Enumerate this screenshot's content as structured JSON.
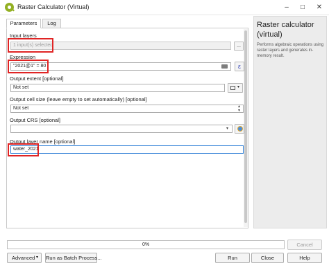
{
  "window": {
    "title": "Raster Calculator (Virtual)"
  },
  "tabs": [
    {
      "label": "Parameters"
    },
    {
      "label": "Log"
    }
  ],
  "params": {
    "input_layers": {
      "label": "Input layers",
      "value": "1 input(s) selected",
      "button": "..."
    },
    "expression": {
      "label": "Expression",
      "value": "\"2021@1\" = 80",
      "button": "ε"
    },
    "output_extent": {
      "label": "Output extent [optional]",
      "value": "Not set"
    },
    "cell_size": {
      "label": "Output cell size (leave empty to set automatically) [optional]",
      "value": "Not set"
    },
    "crs": {
      "label": "Output CRS [optional]",
      "value": ""
    },
    "layer_name": {
      "label": "Output layer name [optional]",
      "value": "water_2021"
    }
  },
  "help_panel": {
    "title": "Raster calculator (virtual)",
    "description": "Performs algebraic operations using raster layers and generates in-memory result."
  },
  "progress": {
    "text": "0%",
    "value": 0
  },
  "buttons": {
    "cancel": "Cancel",
    "advanced": "Advanced",
    "batch": "Run as Batch Process...",
    "run": "Run",
    "close": "Close",
    "help": "Help"
  },
  "colors": {
    "highlight": "#e02424",
    "focus": "#2f7fd6",
    "qgis_green": "#93b023"
  }
}
